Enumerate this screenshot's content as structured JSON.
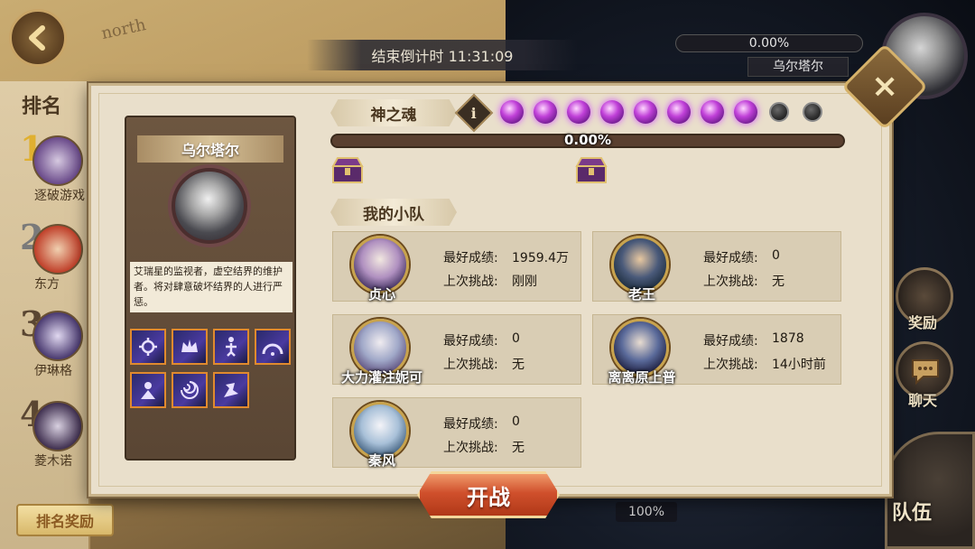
{
  "hud": {
    "countdown": "结束倒计时 11:31:09",
    "boss_hp_percent": "0.00%",
    "boss_name": "乌尔塔尔",
    "team_hp_percent": "100%",
    "map_label": "north"
  },
  "ranking": {
    "title": "排名",
    "entries": [
      {
        "rank": "1",
        "name": "逐破游戏",
        "color": "#e0b030"
      },
      {
        "rank": "2",
        "name": "东方",
        "color": "#7a7a7a"
      },
      {
        "rank": "3",
        "name": "伊琳格",
        "color": "#5a4632"
      },
      {
        "rank": "4",
        "name": "菱木诺",
        "color": "#5a4632"
      }
    ],
    "reward_button": "排名奖励"
  },
  "side_menu": {
    "reward_label": "奖励",
    "chat_label": "聊天",
    "team_label": "队伍"
  },
  "boss_panel": {
    "name": "乌尔塔尔",
    "description": "艾瑞星的监视者，虚空结界的维护者。将对肆意破坏结界的人进行严惩。",
    "skills": [
      "skill-1",
      "skill-2",
      "skill-3",
      "skill-4",
      "skill-5",
      "skill-6",
      "skill-7"
    ]
  },
  "soul": {
    "label": "神之魂",
    "info_symbol": "i",
    "orbs_lit": 8,
    "orbs_total": 10,
    "progress_text": "0.00%",
    "progress": 0.0
  },
  "squad": {
    "label": "我的小队",
    "best_label": "最好成绩:",
    "last_label": "上次挑战:",
    "members": [
      {
        "name": "贞心",
        "best": "1959.4万",
        "last": "刚刚"
      },
      {
        "name": "老王",
        "best": "0",
        "last": "无"
      },
      {
        "name": "大力灌注妮可",
        "best": "0",
        "last": "无"
      },
      {
        "name": "离离原上普",
        "best": "1878",
        "last": "14小时前"
      },
      {
        "name": "秦风",
        "best": "0",
        "last": "无"
      }
    ]
  },
  "fight_button": "开战",
  "colors": {
    "accent_orange": "#d0502c",
    "orb_purple": "#c040d8",
    "panel_bg": "#e9dfcb"
  }
}
